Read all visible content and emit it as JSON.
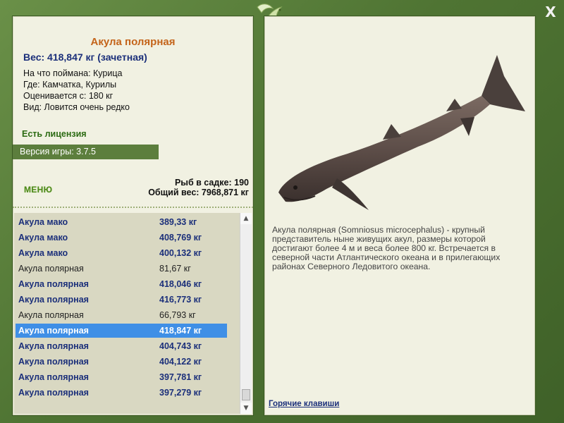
{
  "window": {
    "close_label": "X"
  },
  "fish": {
    "title": "Акула полярная",
    "weight_line": "Вес: 418,847 кг (зачетная)",
    "info": [
      "На что поймана: Курица",
      "Где: Камчатка, Курилы",
      "Оценивается с: 180 кг",
      "Вид: Ловится очень редко"
    ],
    "license": "Есть лицензия",
    "version": "Версия игры: 3.7.5",
    "description": "Акула полярная (Somniosus microcephalus) - крупный представитель ныне живущих акул, размеры которой достигают более 4 м и веса более 800 кг. Встречается в северной части Атлантического океана и в прилегающих районах Северного Ледовитого океана."
  },
  "menu_label": "МЕНЮ",
  "totals": {
    "count_line": "Рыб в садке: 190",
    "weight_line": "Общий вес: 7968,871 кг"
  },
  "catch_list": [
    {
      "name": "Акула мако",
      "weight": "389,33 кг",
      "style": "bold"
    },
    {
      "name": "Акула мако",
      "weight": "408,769 кг",
      "style": "bold"
    },
    {
      "name": "Акула мако",
      "weight": "400,132 кг",
      "style": "bold"
    },
    {
      "name": "Акула полярная",
      "weight": "81,67 кг",
      "style": "plain"
    },
    {
      "name": "Акула полярная",
      "weight": "418,046 кг",
      "style": "bold"
    },
    {
      "name": "Акула полярная",
      "weight": "416,773 кг",
      "style": "bold"
    },
    {
      "name": "Акула полярная",
      "weight": "66,793 кг",
      "style": "plain"
    },
    {
      "name": "Акула полярная",
      "weight": "418,847 кг",
      "style": "selected"
    },
    {
      "name": "Акула полярная",
      "weight": "404,743 кг",
      "style": "bold"
    },
    {
      "name": "Акула полярная",
      "weight": "404,122 кг",
      "style": "bold"
    },
    {
      "name": "Акула полярная",
      "weight": "397,781 кг",
      "style": "bold"
    },
    {
      "name": "Акула полярная",
      "weight": "397,279 кг",
      "style": "bold"
    }
  ],
  "hotkeys_label": "Горячие клавиши",
  "colors": {
    "frame": "#557a38",
    "panel": "#f1f1e2",
    "title": "#c4641a",
    "accent_blue": "#1b2f7a",
    "selection": "#3f8fe6"
  },
  "icons": {
    "logo": "dolphin-logo-icon",
    "close": "close-icon",
    "shark": "greenland-shark-image"
  }
}
